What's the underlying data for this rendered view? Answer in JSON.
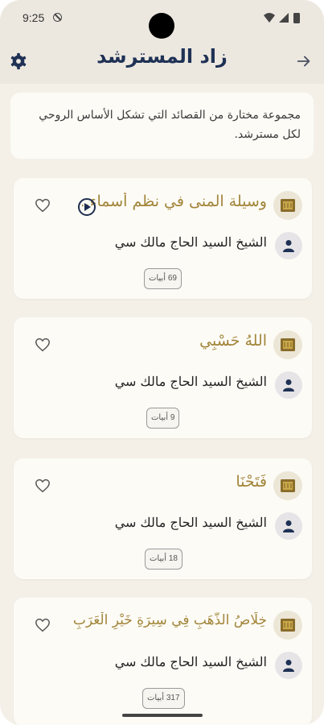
{
  "status_bar": {
    "time": "9:25"
  },
  "header": {
    "title": "زاد المسترشد"
  },
  "intro": {
    "text": "مجموعة مختارة من القصائد التي تشكل الأساس الروحي لكل مسترشد."
  },
  "poems": [
    {
      "title": "وسيلة المنى في نظم أسماء...",
      "author": "الشيخ السيد الحاج مالك سي",
      "verses": "69 أبيات"
    },
    {
      "title": "اللهُ حَسْبِي",
      "author": "الشيخ السيد الحاج مالك سي",
      "verses": "9 أبيات"
    },
    {
      "title": "فَتَحْنَا",
      "author": "الشيخ السيد الحاج مالك سي",
      "verses": "18 أبيات"
    },
    {
      "title": "خِلَاصُ الذَّهَبِ فِي سِيرَةِ خَيْرِ الْعَرَبِ",
      "author": "الشيخ السيد الحاج مالك سي",
      "verses": "317 أبيات"
    }
  ],
  "colors": {
    "title_gold": "#a2853a",
    "header_navy": "#1f3155",
    "background": "#f4f0e8",
    "card": "#fcfbf6"
  },
  "icons": {
    "settings": "gear-icon",
    "back": "arrow-right-icon",
    "poem": "book-icon",
    "author": "person-icon",
    "favorite": "heart-outline-icon",
    "play": "play-circle-icon"
  }
}
